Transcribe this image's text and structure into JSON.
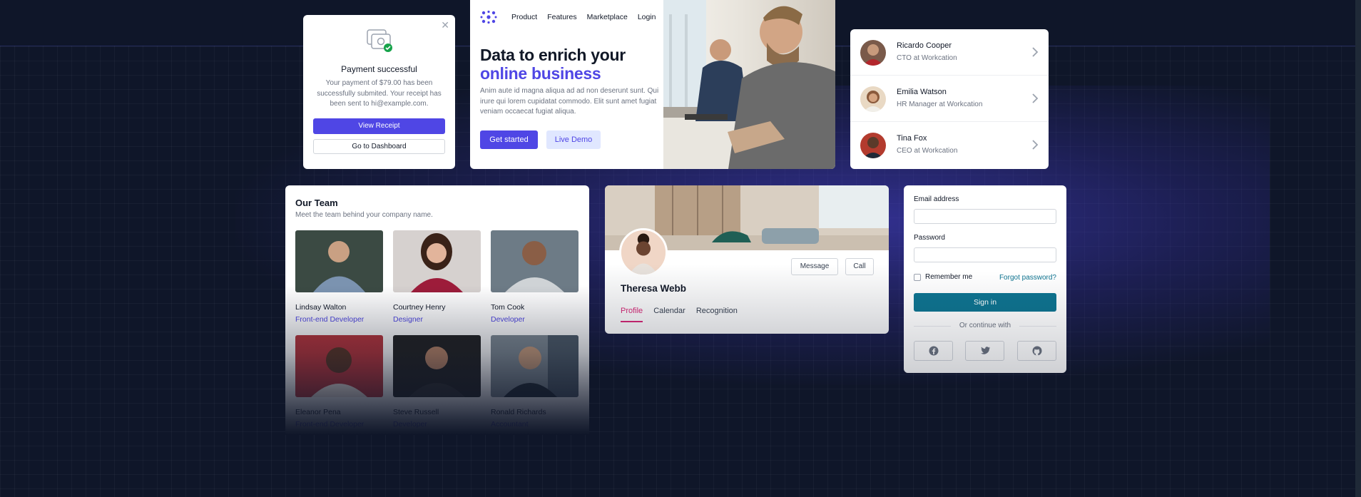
{
  "colors": {
    "accent": "#4f46e5",
    "accent_light": "#e0e7ff",
    "teal": "#0e7490",
    "pink": "#db2777",
    "background": "#0f1629"
  },
  "payment": {
    "icon": "receipt-check-icon",
    "close_icon": "close-icon",
    "title": "Payment successful",
    "message": "Your payment of $79.00 has been successfully submited. Your receipt has been sent to hi@example.com.",
    "primary_button": "View Receipt",
    "secondary_button": "Go to Dashboard"
  },
  "hero": {
    "logo_icon": "workcation-logo-icon",
    "nav": [
      "Product",
      "Features",
      "Marketplace",
      "Login"
    ],
    "headline_1": "Data to enrich your",
    "headline_2": "online business",
    "body": "Anim aute id magna aliqua ad ad non deserunt sunt. Qui irure qui lorem cupidatat commodo. Elit sunt amet fugiat veniam occaecat fugiat aliqua.",
    "cta_primary": "Get started",
    "cta_secondary": "Live Demo"
  },
  "people": [
    {
      "name": "Ricardo Cooper",
      "role": "CTO at Workcation"
    },
    {
      "name": "Emilia Watson",
      "role": "HR Manager at Workcation"
    },
    {
      "name": "Tina Fox",
      "role": "CEO at Workcation"
    }
  ],
  "team": {
    "title": "Our Team",
    "subtitle": "Meet the team behind your company name.",
    "members": [
      {
        "name": "Lindsay Walton",
        "role": "Front-end Developer"
      },
      {
        "name": "Courtney Henry",
        "role": "Designer"
      },
      {
        "name": "Tom Cook",
        "role": "Developer"
      },
      {
        "name": "Eleanor Pena",
        "role": "Front-end Developer"
      },
      {
        "name": "Steve Russell",
        "role": "Developer"
      },
      {
        "name": "Ronald Richards",
        "role": "Accountant"
      }
    ]
  },
  "profile": {
    "name": "Theresa Webb",
    "message_button": "Message",
    "call_button": "Call",
    "tabs": [
      "Profile",
      "Calendar",
      "Recognition"
    ],
    "active_tab": "Profile"
  },
  "login": {
    "email_label": "Email address",
    "password_label": "Password",
    "remember_label": "Remember me",
    "forgot_link": "Forgot password?",
    "submit_button": "Sign in",
    "divider_text": "Or continue with",
    "social_icons": [
      "facebook-icon",
      "twitter-icon",
      "github-icon"
    ]
  }
}
